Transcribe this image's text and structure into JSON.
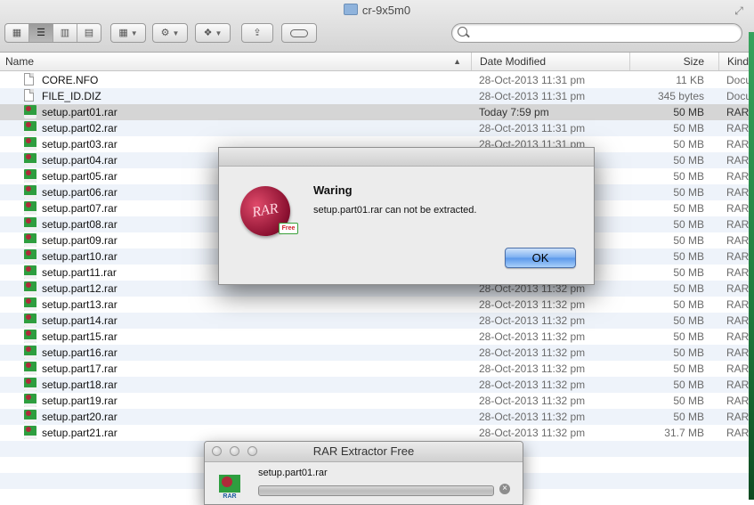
{
  "window": {
    "title": "cr-9x5m0"
  },
  "toolbar": {
    "view_icon": "icon-view",
    "view_list": "list-view",
    "view_column": "column-view",
    "view_coverflow": "cover-flow",
    "arrange_icon": "grid-arrange-icon",
    "action_icon": "gear-icon",
    "dropbox_icon": "dropbox-icon",
    "share_icon": "share-icon",
    "tags_icon": "label-icon",
    "search_placeholder": ""
  },
  "columns": {
    "name": "Name",
    "date": "Date Modified",
    "size": "Size",
    "kind": "Kind"
  },
  "files": [
    {
      "icon": "document",
      "name": "CORE.NFO",
      "date": "28-Oct-2013 11:31 pm",
      "size": "11 KB",
      "kind": "Docu"
    },
    {
      "icon": "document",
      "name": "FILE_ID.DIZ",
      "date": "28-Oct-2013 11:31 pm",
      "size": "345 bytes",
      "kind": "Docu"
    },
    {
      "icon": "rar",
      "name": "setup.part01.rar",
      "date": "Today 7:59 pm",
      "size": "50 MB",
      "kind": "RAR",
      "selected": true
    },
    {
      "icon": "rar",
      "name": "setup.part02.rar",
      "date": "28-Oct-2013 11:31 pm",
      "size": "50 MB",
      "kind": "RAR"
    },
    {
      "icon": "rar",
      "name": "setup.part03.rar",
      "date": "28-Oct-2013 11:31 pm",
      "size": "50 MB",
      "kind": "RAR"
    },
    {
      "icon": "rar",
      "name": "setup.part04.rar",
      "date": "",
      "size": "50 MB",
      "kind": "RAR"
    },
    {
      "icon": "rar",
      "name": "setup.part05.rar",
      "date": "",
      "size": "50 MB",
      "kind": "RAR"
    },
    {
      "icon": "rar",
      "name": "setup.part06.rar",
      "date": "",
      "size": "50 MB",
      "kind": "RAR"
    },
    {
      "icon": "rar",
      "name": "setup.part07.rar",
      "date": "",
      "size": "50 MB",
      "kind": "RAR"
    },
    {
      "icon": "rar",
      "name": "setup.part08.rar",
      "date": "",
      "size": "50 MB",
      "kind": "RAR"
    },
    {
      "icon": "rar",
      "name": "setup.part09.rar",
      "date": "",
      "size": "50 MB",
      "kind": "RAR"
    },
    {
      "icon": "rar",
      "name": "setup.part10.rar",
      "date": "",
      "size": "50 MB",
      "kind": "RAR"
    },
    {
      "icon": "rar",
      "name": "setup.part11.rar",
      "date": "",
      "size": "50 MB",
      "kind": "RAR"
    },
    {
      "icon": "rar",
      "name": "setup.part12.rar",
      "date": "28-Oct-2013 11:32 pm",
      "size": "50 MB",
      "kind": "RAR"
    },
    {
      "icon": "rar",
      "name": "setup.part13.rar",
      "date": "28-Oct-2013 11:32 pm",
      "size": "50 MB",
      "kind": "RAR"
    },
    {
      "icon": "rar",
      "name": "setup.part14.rar",
      "date": "28-Oct-2013 11:32 pm",
      "size": "50 MB",
      "kind": "RAR"
    },
    {
      "icon": "rar",
      "name": "setup.part15.rar",
      "date": "28-Oct-2013 11:32 pm",
      "size": "50 MB",
      "kind": "RAR"
    },
    {
      "icon": "rar",
      "name": "setup.part16.rar",
      "date": "28-Oct-2013 11:32 pm",
      "size": "50 MB",
      "kind": "RAR"
    },
    {
      "icon": "rar",
      "name": "setup.part17.rar",
      "date": "28-Oct-2013 11:32 pm",
      "size": "50 MB",
      "kind": "RAR"
    },
    {
      "icon": "rar",
      "name": "setup.part18.rar",
      "date": "28-Oct-2013 11:32 pm",
      "size": "50 MB",
      "kind": "RAR"
    },
    {
      "icon": "rar",
      "name": "setup.part19.rar",
      "date": "28-Oct-2013 11:32 pm",
      "size": "50 MB",
      "kind": "RAR"
    },
    {
      "icon": "rar",
      "name": "setup.part20.rar",
      "date": "28-Oct-2013 11:32 pm",
      "size": "50 MB",
      "kind": "RAR"
    },
    {
      "icon": "rar",
      "name": "setup.part21.rar",
      "date": "28-Oct-2013 11:32 pm",
      "size": "31.7 MB",
      "kind": "RAR"
    }
  ],
  "alert": {
    "title": "Waring",
    "message": "setup.part01.rar can not be extracted.",
    "ok_label": "OK",
    "logo_text": "RAR",
    "badge_text": "Free"
  },
  "extractor": {
    "title": "RAR Extractor Free",
    "file": "setup.part01.rar",
    "icon_text": "RAR",
    "progress": 0
  },
  "colors": {
    "selection": "#d5d5d5",
    "alt_row": "#eef3fa",
    "ok_button": "#5a97ea"
  }
}
